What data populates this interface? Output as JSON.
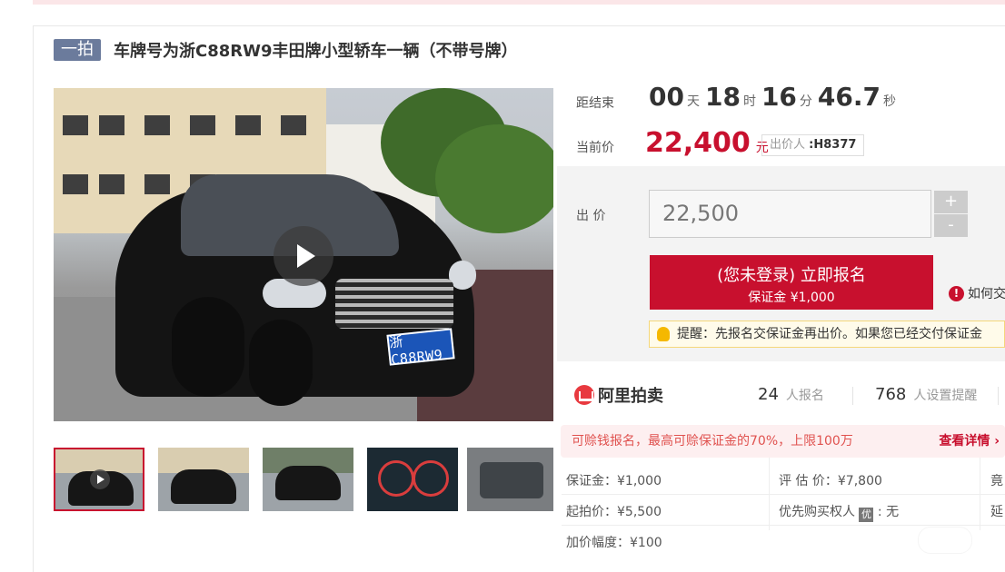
{
  "header": {
    "tag": "一拍",
    "title": "车牌号为浙C88RW9丰田牌小型轿车一辆（不带号牌）"
  },
  "media": {
    "plate_text": "浙C88RW9",
    "play_icon": "play-icon"
  },
  "countdown": {
    "label": "距结束",
    "days": "00",
    "days_unit": "天",
    "hours": "18",
    "hours_unit": "时",
    "minutes": "16",
    "minutes_unit": "分",
    "seconds": "46.7",
    "seconds_unit": "秒"
  },
  "current": {
    "label": "当前价",
    "price": "22,400",
    "unit": "元",
    "bidder_label": "出价人",
    "bidder": ":H8377"
  },
  "bid": {
    "label": "出 价",
    "value": "22,500",
    "plus": "+",
    "minus": "-"
  },
  "signup": {
    "line1": "(您未登录) 立即报名",
    "line2": "保证金 ¥1,000"
  },
  "howto": {
    "icon": "!",
    "text": "如何交"
  },
  "reminder": {
    "text": "提醒：先报名交保证金再出价。如果您已经交付保证金"
  },
  "platform": {
    "name": "阿里拍卖"
  },
  "stats": {
    "signup_count": "24",
    "signup_text": "人报名",
    "reminder_count": "768",
    "reminder_text": "人设置提醒"
  },
  "loan": {
    "text": "可赊钱报名，最高可赊保证金的70%，上限100万",
    "detail": "查看详情 ›"
  },
  "info": {
    "deposit": "保证金：¥1,000",
    "appraisal": "评 估 价：¥7,800",
    "col3_r1": "竟",
    "start_price": "起拍价：¥5,500",
    "priority_label": "优先购买权人",
    "priority_badge": "优",
    "priority_value": ": 无",
    "col3_r2": "延",
    "increment": "加价幅度：¥100"
  },
  "colors": {
    "accent": "#c8102e",
    "tag": "#6b7b9c",
    "loan_bg": "#fdeff0"
  }
}
